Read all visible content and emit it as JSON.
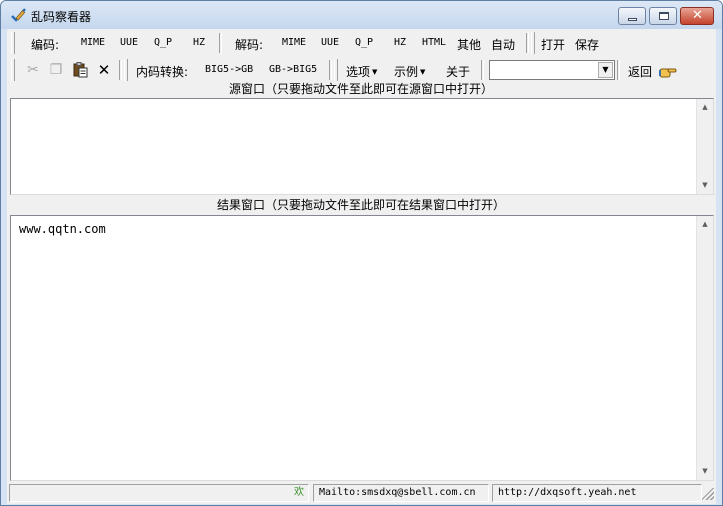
{
  "window": {
    "title": "乱码察看器",
    "icon": "pen-check-icon"
  },
  "toolbar1": {
    "encode_label": "编码:",
    "encode_mime": "MIME",
    "encode_uue": "UUE",
    "encode_qp": "Q_P",
    "encode_hz": "HZ",
    "decode_label": "解码:",
    "decode_mime": "MIME",
    "decode_uue": "UUE",
    "decode_qp": "Q_P",
    "decode_hz": "HZ",
    "decode_html": "HTML",
    "decode_other": "其他",
    "decode_auto": "自动",
    "open": "打开",
    "save": "保存"
  },
  "toolbar2": {
    "cut_icon": "scissors-icon",
    "copy_icon": "copy-icon",
    "paste_icon": "clipboard-icon",
    "delete_icon": "delete-x-icon",
    "convert_label": "内码转换:",
    "big5_to_gb": "BIG5->GB",
    "gb_to_big5": "GB->BIG5",
    "options": "选项",
    "examples": "示例",
    "about": "关于",
    "combo_value": "",
    "back": "返回"
  },
  "source_panel": {
    "title": "源窗口（只要拖动文件至此即可在源窗口中打开）",
    "content": ""
  },
  "result_panel": {
    "title": "结果窗口（只要拖动文件至此即可在结果窗口中打开）",
    "content": "www.qqtn.com"
  },
  "statusbar": {
    "main_text": "",
    "icon_char": "欢",
    "mailto": "Mailto:smsdxq@sbell.com.cn",
    "url": "http://dxqsoft.yeah.net"
  }
}
